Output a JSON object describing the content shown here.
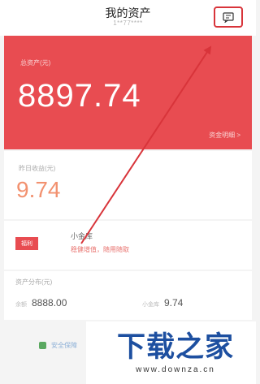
{
  "header": {
    "title": "我的资产",
    "subtitle": "1**77****"
  },
  "total": {
    "label": "总资产(元)",
    "amount": "8897.74",
    "link": "资金明细 >"
  },
  "earnings": {
    "label": "昨日收益(元)",
    "amount": "9.74"
  },
  "promo": {
    "badge": "福利",
    "title": "小金库",
    "desc": "稳健增值，随用随取"
  },
  "assets": {
    "label": "资产分布(元)",
    "left_key": "余额",
    "left_value": "8888.00",
    "right_key": "小金库",
    "right_value": "9.74"
  },
  "bottom": {
    "text": "安全保障"
  },
  "watermark": {
    "title": "下载之家",
    "url": "www.downza.cn"
  },
  "colors": {
    "red": "#e84c51",
    "highlight": "#d8343a",
    "watermark_blue": "#1d4fa0"
  }
}
